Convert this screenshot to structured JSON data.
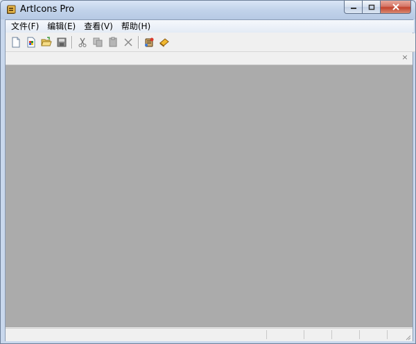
{
  "window": {
    "title": "ArtIcons Pro"
  },
  "menu": {
    "items": [
      {
        "label": "文件(F)",
        "key": "file"
      },
      {
        "label": "编辑(E)",
        "key": "edit"
      },
      {
        "label": "查看(V)",
        "key": "view"
      },
      {
        "label": "帮助(H)",
        "key": "help"
      }
    ]
  },
  "toolbar": {
    "buttons": [
      "new-document-icon",
      "new-library-icon",
      "open-folder-icon",
      "save-icon",
      "cut-icon",
      "copy-icon",
      "paste-icon",
      "delete-icon",
      "wizard-icon",
      "help-book-icon"
    ]
  },
  "docbar": {
    "close_glyph": "×"
  },
  "colors": {
    "workspace": "#ababab",
    "chrome": "#f0f0f0",
    "title_gradient_top": "#d9e5f6",
    "close_button": "#c3432d"
  }
}
